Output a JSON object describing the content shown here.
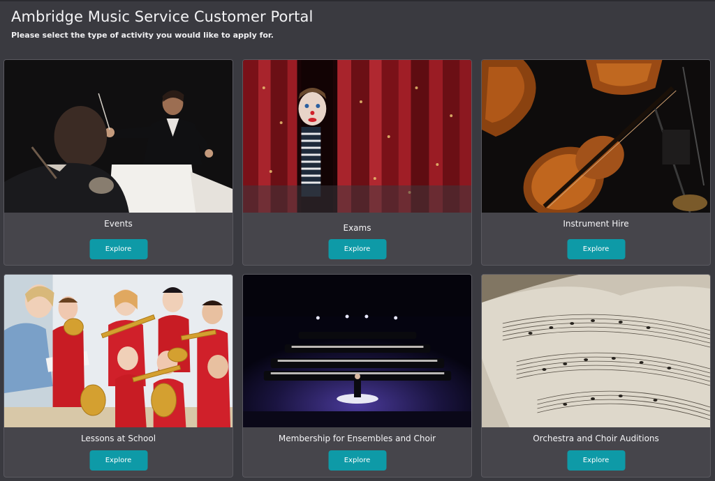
{
  "header": {
    "title": "Ambridge Music Service Customer Portal",
    "subtitle": "Please select the type of activity you would like to apply for."
  },
  "cards": [
    {
      "label": "Events",
      "button": "Explore",
      "image": "conductor-photo"
    },
    {
      "label": "Exams",
      "button": "Explore",
      "image": "stage-curtain-photo"
    },
    {
      "label": "Instrument Hire",
      "button": "Explore",
      "image": "cellos-photo"
    },
    {
      "label": "Lessons at School",
      "button": "Explore",
      "image": "school-brass-photo"
    },
    {
      "label": "Membership for Ensembles and Choir",
      "button": "Explore",
      "image": "concert-band-photo"
    },
    {
      "label": "Orchestra and Choir Auditions",
      "button": "Explore",
      "image": "sheet-music-photo"
    }
  ],
  "colors": {
    "background": "#3a3a40",
    "card": "#46454b",
    "button": "#0e9aa7"
  }
}
